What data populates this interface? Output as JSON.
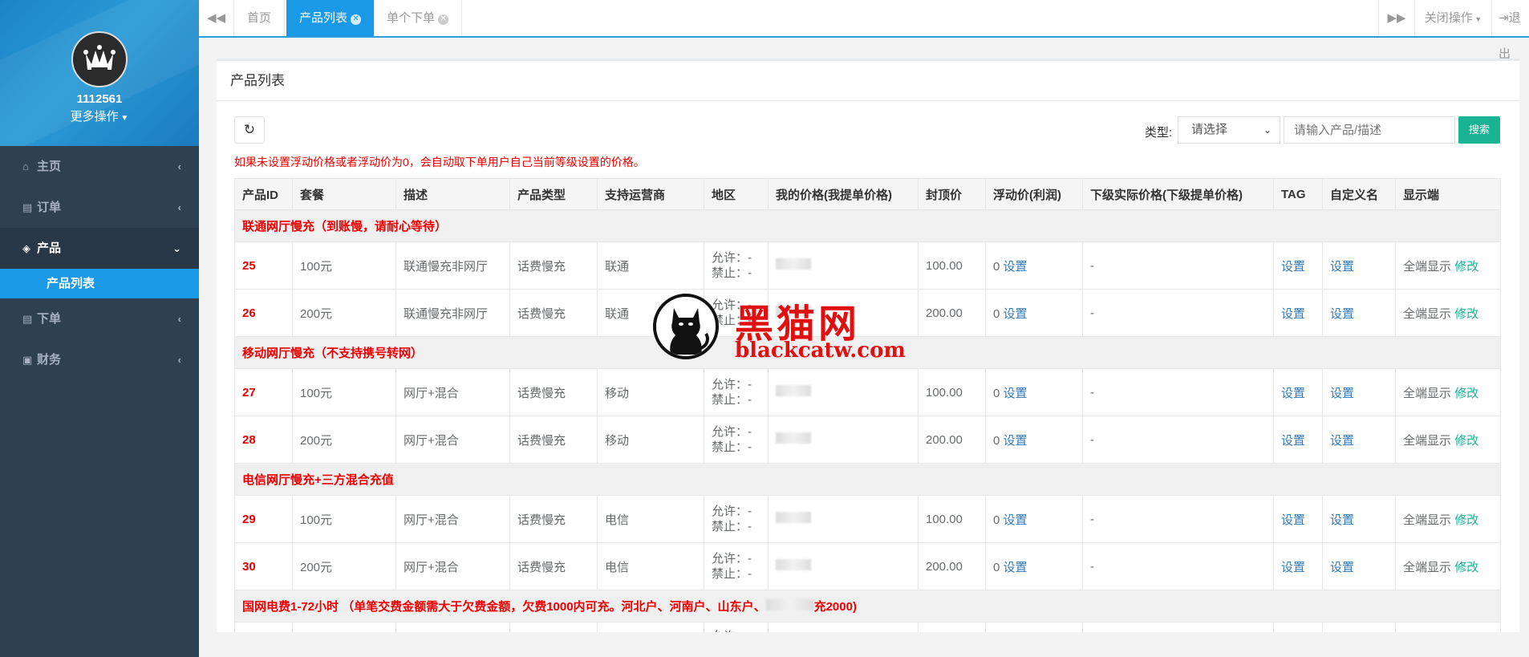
{
  "sidebar": {
    "username": "1112561",
    "more_ops": "更多操作",
    "items": [
      {
        "label": "主页",
        "icon": "home-icon"
      },
      {
        "label": "订单",
        "icon": "file-icon"
      },
      {
        "label": "产品",
        "icon": "cube-icon"
      },
      {
        "label": "下单",
        "icon": "file-icon"
      },
      {
        "label": "财务",
        "icon": "money-icon"
      }
    ],
    "sub_item": "产品列表"
  },
  "topbar": {
    "tabs": [
      {
        "label": "首页"
      },
      {
        "label": "产品列表"
      },
      {
        "label": "单个下单"
      }
    ],
    "close_ops": "关闭操作",
    "logout": "退出"
  },
  "panel": {
    "title": "产品列表",
    "type_label": "类型:",
    "type_select": "请选择",
    "search_placeholder": "请输入产品/描述",
    "search_button": "搜索",
    "notice": "如果未设置浮动价格或者浮动价为0，会自动取下单用户自己当前等级设置的价格。"
  },
  "table": {
    "headers": [
      "产品ID",
      "套餐",
      "描述",
      "产品类型",
      "支持运营商",
      "地区",
      "我的价格(我提单价格)",
      "封顶价",
      "浮动价(利润)",
      "下级实际价格(下级提单价格)",
      "TAG",
      "自定义名",
      "显示端"
    ],
    "groups": [
      {
        "title": "联通网厅慢充（到账慢，请耐心等待）",
        "rows": [
          {
            "id": "25",
            "package": "100元",
            "desc": "联通慢充非网厅",
            "type": "话费慢充",
            "carrier": "联通",
            "allow": "允许：-",
            "deny": "禁止：-",
            "cap": "100.00",
            "float": "0",
            "float_link": "设置",
            "sub_price": "-",
            "tag": "设置",
            "custom": "设置",
            "display": "全端显示",
            "modify": "修改"
          },
          {
            "id": "26",
            "package": "200元",
            "desc": "联通慢充非网厅",
            "type": "话费慢充",
            "carrier": "联通",
            "allow": "允许：-",
            "deny": "禁止：-",
            "cap": "200.00",
            "float": "0",
            "float_link": "设置",
            "sub_price": "-",
            "tag": "设置",
            "custom": "设置",
            "display": "全端显示",
            "modify": "修改"
          }
        ]
      },
      {
        "title": "移动网厅慢充（不支持携号转网）",
        "rows": [
          {
            "id": "27",
            "package": "100元",
            "desc": "网厅+混合",
            "type": "话费慢充",
            "carrier": "移动",
            "allow": "允许：-",
            "deny": "禁止：-",
            "cap": "100.00",
            "float": "0",
            "float_link": "设置",
            "sub_price": "-",
            "tag": "设置",
            "custom": "设置",
            "display": "全端显示",
            "modify": "修改"
          },
          {
            "id": "28",
            "package": "200元",
            "desc": "网厅+混合",
            "type": "话费慢充",
            "carrier": "移动",
            "allow": "允许：-",
            "deny": "禁止：-",
            "cap": "200.00",
            "float": "0",
            "float_link": "设置",
            "sub_price": "-",
            "tag": "设置",
            "custom": "设置",
            "display": "全端显示",
            "modify": "修改"
          }
        ]
      },
      {
        "title": "电信网厅慢充+三方混合充值",
        "rows": [
          {
            "id": "29",
            "package": "100元",
            "desc": "网厅+混合",
            "type": "话费慢充",
            "carrier": "电信",
            "allow": "允许：-",
            "deny": "禁止：-",
            "cap": "100.00",
            "float": "0",
            "float_link": "设置",
            "sub_price": "-",
            "tag": "设置",
            "custom": "设置",
            "display": "全端显示",
            "modify": "修改"
          },
          {
            "id": "30",
            "package": "200元",
            "desc": "网厅+混合",
            "type": "话费慢充",
            "carrier": "电信",
            "allow": "允许：-",
            "deny": "禁止：-",
            "cap": "200.00",
            "float": "0",
            "float_link": "设置",
            "sub_price": "-",
            "tag": "设置",
            "custom": "设置",
            "display": "全端显示",
            "modify": "修改"
          }
        ]
      },
      {
        "title": "国网电费1-72小时 （单笔交费金额需大于欠费金额，欠费1000内可充。河北户、河南户、山东户、",
        "title_tail": "充2000)",
        "rows": [
          {
            "allow": "允许：-"
          }
        ]
      }
    ]
  },
  "watermark": {
    "text_cn": "黑猫网",
    "text_url": "blackcatw.com"
  },
  "colors": {
    "sidebar_bg": "#2f4050",
    "accent_blue": "#1a9ae6",
    "search_green": "#1ab394",
    "red_text": "#e00000",
    "link_blue": "#337ab7"
  }
}
